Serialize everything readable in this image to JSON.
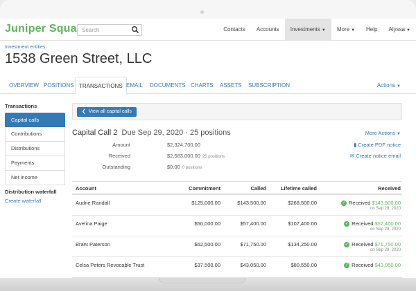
{
  "brand": {
    "name": "Juniper Square",
    "color": "#5cb85c"
  },
  "search": {
    "placeholder": "Search"
  },
  "nav": {
    "contacts": "Contacts",
    "accounts": "Accounts",
    "investments": "Investments",
    "more": "More",
    "help": "Help",
    "user": "Alyssa"
  },
  "breadcrumb": "Investment entities",
  "title": "1538 Green Street, LLC",
  "tabs": [
    "OVERVIEW",
    "POSITIONS",
    "TRANSACTIONS",
    "EMAIL",
    "DOCUMENTS",
    "CHARTS",
    "ASSETS",
    "SUBSCRIPTION"
  ],
  "tabs_actions": "Actions",
  "sidebar": {
    "heading": "Transactions",
    "items": [
      "Capital calls",
      "Contributions",
      "Distributions",
      "Payments",
      "Net income"
    ],
    "waterfall_heading": "Distribution waterfall",
    "waterfall_link": "Create waterfall"
  },
  "view_all_label": "View all capital calls",
  "call": {
    "name": "Capital Call 2",
    "due": "Due Sep 29, 2020 · 25 positions",
    "more_actions": "More Actions",
    "pdf": "Create PDF notice",
    "email": "Create notice email"
  },
  "summary": {
    "amount_label": "Amount",
    "amount": "$2,324,700.00",
    "received_label": "Received",
    "received": "$2,583,000.00",
    "received_note": "25 positions",
    "outstanding_label": "Outstanding",
    "outstanding": "$0.00",
    "outstanding_note": "0 positions"
  },
  "table": {
    "headers": {
      "account": "Account",
      "commitment": "Commitment",
      "called": "Called",
      "lifetime": "Lifetime called",
      "received": "Received"
    },
    "rows": [
      {
        "account": "Audrie Randall",
        "commitment": "$125,000.00",
        "called": "$143,500.00",
        "lifetime": "$268,500.00",
        "status": "Received",
        "amount": "$143,500.00",
        "date": "on Sep 29, 2020"
      },
      {
        "account": "Avelina Paige",
        "commitment": "$50,000.00",
        "called": "$57,400.00",
        "lifetime": "$107,400.00",
        "status": "Received",
        "amount": "$57,400.00",
        "date": "on Sep 29, 2020"
      },
      {
        "account": "Brant Paterson",
        "commitment": "$62,500.00",
        "called": "$71,750.00",
        "lifetime": "$134,250.00",
        "status": "Received",
        "amount": "$71,750.00",
        "date": "on Sep 29, 2020"
      },
      {
        "account": "Celsa Peters Revocable Trust",
        "commitment": "$37,500.00",
        "called": "$43,050.00",
        "lifetime": "$80,550.00",
        "status": "Received",
        "amount": "$43,050.00",
        "date": ""
      }
    ]
  },
  "colors": {
    "link": "#337ab7",
    "success": "#5cb85c"
  }
}
